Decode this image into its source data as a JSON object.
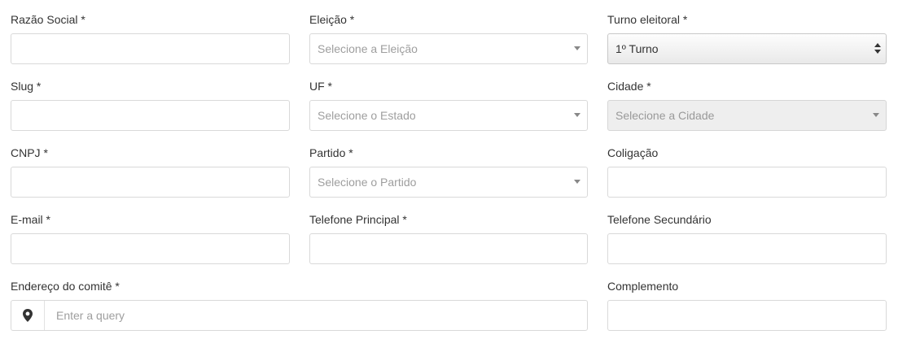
{
  "form": {
    "razao_social": {
      "label": "Razão Social *",
      "value": ""
    },
    "eleicao": {
      "label": "Eleição *",
      "placeholder": "Selecione a Eleição"
    },
    "turno": {
      "label": "Turno eleitoral *",
      "value": "1º Turno"
    },
    "slug": {
      "label": "Slug *",
      "value": ""
    },
    "uf": {
      "label": "UF *",
      "placeholder": "Selecione o Estado"
    },
    "cidade": {
      "label": "Cidade *",
      "placeholder": "Selecione a Cidade"
    },
    "cnpj": {
      "label": "CNPJ *",
      "value": ""
    },
    "partido": {
      "label": "Partido *",
      "placeholder": "Selecione o Partido"
    },
    "coligacao": {
      "label": "Coligação",
      "value": ""
    },
    "email": {
      "label": "E-mail *",
      "value": ""
    },
    "telefone_principal": {
      "label": "Telefone Principal *",
      "value": ""
    },
    "telefone_secundario": {
      "label": "Telefone Secundário",
      "value": ""
    },
    "endereco": {
      "label": "Endereço do comitê *",
      "placeholder": "Enter a query"
    },
    "complemento": {
      "label": "Complemento",
      "value": ""
    }
  },
  "icons": {
    "address_addon": "map-pin-icon",
    "select_caret": "caret-down-icon",
    "native_select": "updown-stepper-icon"
  },
  "colors": {
    "label": "#333333",
    "placeholder": "#9e9e9e",
    "border": "#d9d9d9",
    "disabled_bg": "#eeeeee"
  }
}
